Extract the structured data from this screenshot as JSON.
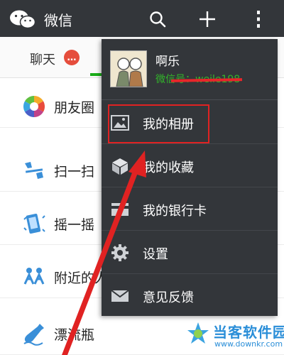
{
  "header": {
    "title": "微信",
    "icons": [
      "wechat-logo-icon",
      "search-icon",
      "plus-icon",
      "more-icon"
    ]
  },
  "tabs": {
    "chat_label": "聊天",
    "chat_badge": "…"
  },
  "list": {
    "items": [
      {
        "label": "朋友圈",
        "icon": "moments-icon"
      },
      {
        "label": "扫一扫",
        "icon": "scan-icon"
      },
      {
        "label": "摇一摇",
        "icon": "shake-icon"
      },
      {
        "label": "附近的人",
        "icon": "people-nearby-icon"
      },
      {
        "label": "漂流瓶",
        "icon": "drift-bottle-icon"
      }
    ]
  },
  "menu": {
    "user_name": "啊乐",
    "wechat_id": "微信号：weile198",
    "items": [
      {
        "label": "我的相册",
        "icon": "photo-album-icon"
      },
      {
        "label": "我的收藏",
        "icon": "favorites-icon"
      },
      {
        "label": "我的银行卡",
        "icon": "bank-card-icon"
      },
      {
        "label": "设置",
        "icon": "settings-icon"
      },
      {
        "label": "意见反馈",
        "icon": "feedback-icon"
      }
    ]
  },
  "watermark": {
    "title": "当客软件园",
    "url": "www.downkr.com"
  },
  "colors": {
    "top_bar": "#33363a",
    "menu_bg": "#33363a",
    "accent_green": "#1aad19",
    "wechat_id_green": "#32b52a",
    "badge_red": "#e54d3c",
    "annotation_red": "#e02222"
  }
}
